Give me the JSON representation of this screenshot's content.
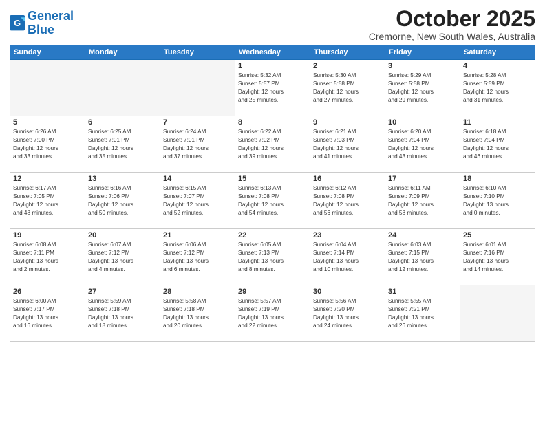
{
  "header": {
    "logo": "GeneralBlue",
    "month": "October 2025",
    "location": "Cremorne, New South Wales, Australia"
  },
  "weekdays": [
    "Sunday",
    "Monday",
    "Tuesday",
    "Wednesday",
    "Thursday",
    "Friday",
    "Saturday"
  ],
  "weeks": [
    [
      {
        "day": "",
        "info": ""
      },
      {
        "day": "",
        "info": ""
      },
      {
        "day": "",
        "info": ""
      },
      {
        "day": "1",
        "info": "Sunrise: 5:32 AM\nSunset: 5:57 PM\nDaylight: 12 hours\nand 25 minutes."
      },
      {
        "day": "2",
        "info": "Sunrise: 5:30 AM\nSunset: 5:58 PM\nDaylight: 12 hours\nand 27 minutes."
      },
      {
        "day": "3",
        "info": "Sunrise: 5:29 AM\nSunset: 5:58 PM\nDaylight: 12 hours\nand 29 minutes."
      },
      {
        "day": "4",
        "info": "Sunrise: 5:28 AM\nSunset: 5:59 PM\nDaylight: 12 hours\nand 31 minutes."
      }
    ],
    [
      {
        "day": "5",
        "info": "Sunrise: 6:26 AM\nSunset: 7:00 PM\nDaylight: 12 hours\nand 33 minutes."
      },
      {
        "day": "6",
        "info": "Sunrise: 6:25 AM\nSunset: 7:01 PM\nDaylight: 12 hours\nand 35 minutes."
      },
      {
        "day": "7",
        "info": "Sunrise: 6:24 AM\nSunset: 7:01 PM\nDaylight: 12 hours\nand 37 minutes."
      },
      {
        "day": "8",
        "info": "Sunrise: 6:22 AM\nSunset: 7:02 PM\nDaylight: 12 hours\nand 39 minutes."
      },
      {
        "day": "9",
        "info": "Sunrise: 6:21 AM\nSunset: 7:03 PM\nDaylight: 12 hours\nand 41 minutes."
      },
      {
        "day": "10",
        "info": "Sunrise: 6:20 AM\nSunset: 7:04 PM\nDaylight: 12 hours\nand 43 minutes."
      },
      {
        "day": "11",
        "info": "Sunrise: 6:18 AM\nSunset: 7:04 PM\nDaylight: 12 hours\nand 46 minutes."
      }
    ],
    [
      {
        "day": "12",
        "info": "Sunrise: 6:17 AM\nSunset: 7:05 PM\nDaylight: 12 hours\nand 48 minutes."
      },
      {
        "day": "13",
        "info": "Sunrise: 6:16 AM\nSunset: 7:06 PM\nDaylight: 12 hours\nand 50 minutes."
      },
      {
        "day": "14",
        "info": "Sunrise: 6:15 AM\nSunset: 7:07 PM\nDaylight: 12 hours\nand 52 minutes."
      },
      {
        "day": "15",
        "info": "Sunrise: 6:13 AM\nSunset: 7:08 PM\nDaylight: 12 hours\nand 54 minutes."
      },
      {
        "day": "16",
        "info": "Sunrise: 6:12 AM\nSunset: 7:08 PM\nDaylight: 12 hours\nand 56 minutes."
      },
      {
        "day": "17",
        "info": "Sunrise: 6:11 AM\nSunset: 7:09 PM\nDaylight: 12 hours\nand 58 minutes."
      },
      {
        "day": "18",
        "info": "Sunrise: 6:10 AM\nSunset: 7:10 PM\nDaylight: 13 hours\nand 0 minutes."
      }
    ],
    [
      {
        "day": "19",
        "info": "Sunrise: 6:08 AM\nSunset: 7:11 PM\nDaylight: 13 hours\nand 2 minutes."
      },
      {
        "day": "20",
        "info": "Sunrise: 6:07 AM\nSunset: 7:12 PM\nDaylight: 13 hours\nand 4 minutes."
      },
      {
        "day": "21",
        "info": "Sunrise: 6:06 AM\nSunset: 7:12 PM\nDaylight: 13 hours\nand 6 minutes."
      },
      {
        "day": "22",
        "info": "Sunrise: 6:05 AM\nSunset: 7:13 PM\nDaylight: 13 hours\nand 8 minutes."
      },
      {
        "day": "23",
        "info": "Sunrise: 6:04 AM\nSunset: 7:14 PM\nDaylight: 13 hours\nand 10 minutes."
      },
      {
        "day": "24",
        "info": "Sunrise: 6:03 AM\nSunset: 7:15 PM\nDaylight: 13 hours\nand 12 minutes."
      },
      {
        "day": "25",
        "info": "Sunrise: 6:01 AM\nSunset: 7:16 PM\nDaylight: 13 hours\nand 14 minutes."
      }
    ],
    [
      {
        "day": "26",
        "info": "Sunrise: 6:00 AM\nSunset: 7:17 PM\nDaylight: 13 hours\nand 16 minutes."
      },
      {
        "day": "27",
        "info": "Sunrise: 5:59 AM\nSunset: 7:18 PM\nDaylight: 13 hours\nand 18 minutes."
      },
      {
        "day": "28",
        "info": "Sunrise: 5:58 AM\nSunset: 7:18 PM\nDaylight: 13 hours\nand 20 minutes."
      },
      {
        "day": "29",
        "info": "Sunrise: 5:57 AM\nSunset: 7:19 PM\nDaylight: 13 hours\nand 22 minutes."
      },
      {
        "day": "30",
        "info": "Sunrise: 5:56 AM\nSunset: 7:20 PM\nDaylight: 13 hours\nand 24 minutes."
      },
      {
        "day": "31",
        "info": "Sunrise: 5:55 AM\nSunset: 7:21 PM\nDaylight: 13 hours\nand 26 minutes."
      },
      {
        "day": "",
        "info": ""
      }
    ]
  ]
}
